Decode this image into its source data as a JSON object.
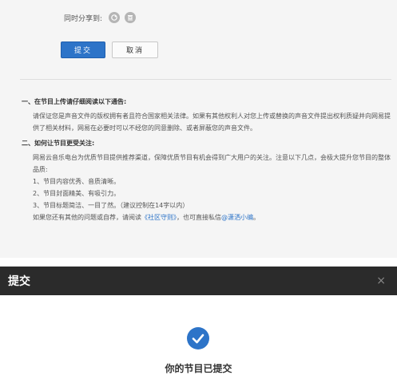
{
  "share": {
    "label": "同时分享到:",
    "icons": [
      "weibo-icon",
      "douban-icon"
    ]
  },
  "buttons": {
    "submit": "提交",
    "cancel": "取消"
  },
  "notice": {
    "section1": {
      "heading": "一、在节目上传请仔细阅读以下通告:",
      "body": "请保证您是声音文件的版权拥有者且符合国家相关法律。如果有其他权利人对您上传或替换的声音文件提出权利质疑并向网易提供了相关材料，网易在必要时可以不经您的同意删除、或者屏蔽您的声音文件。"
    },
    "section2": {
      "heading": "二、如何让节目更受关注:",
      "intro": "网易云音乐电台为优质节目提供推荐渠道，保障优质节目有机会得到广大用户的关注。注意以下几点，会极大提升您节目的整体品质:",
      "items": [
        "1、节目内容优秀、音质清晰。",
        "2、节目封面精美、有吸引力。",
        "3、节目标题简洁、一目了然。（建议控制在14字以内）"
      ],
      "footer_prefix": "如果您还有其他的问题或自荐，请阅读",
      "footer_link1": "《社区守则》",
      "footer_mid": "，也可直接私信",
      "footer_link2": "@潇洒小编",
      "footer_suffix": "。"
    }
  },
  "dialog": {
    "title": "提交",
    "close": "×",
    "message": "你的节目已提交",
    "icon": "check-circle-icon"
  },
  "colors": {
    "accent": "#2d74c8",
    "header": "#2b2b2b",
    "page_bg": "#f5f5f5"
  }
}
